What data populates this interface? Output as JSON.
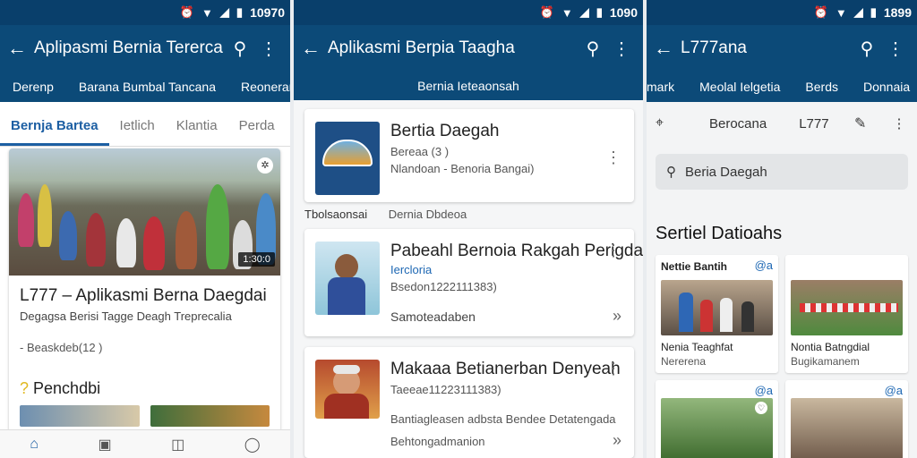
{
  "screen1": {
    "status": {
      "time": "10970"
    },
    "appbar": {
      "back_icon": "arrow-left-icon",
      "title": "Aplipasmi Bernia Tererca",
      "search_icon": "search-icon",
      "more_icon": "more-vert-icon"
    },
    "subnav": [
      "Derenp",
      "Barana  Bumbal Tancana",
      "Reonerana"
    ],
    "tabs": [
      {
        "label": "Bernja Bartea",
        "active": true
      },
      {
        "label": "Ietlich",
        "active": false
      },
      {
        "label": "Klantia",
        "active": false
      },
      {
        "label": "Perda",
        "active": false
      }
    ],
    "card": {
      "duration": "1:30:0",
      "title": "L777 – Aplikasmi Berna Daegdai",
      "subtitle": "Degagsa Berisi Tagge Deagh Treprecalia",
      "meta": "- Beaskdeb(12 )",
      "section": "Penchdbi"
    },
    "bottomnav": [
      "home-icon",
      "news-icon",
      "bookmark-icon",
      "chat-icon"
    ]
  },
  "screen2": {
    "status": {
      "time": "1090"
    },
    "appbar": {
      "back_icon": "arrow-left-icon",
      "title": "Aplikasmi Berpia Taagha",
      "search_icon": "search-icon",
      "more_icon": "more-vert-icon"
    },
    "subtitle": "Bernia Ieteaonsah",
    "app": {
      "title": "Bertia Daegah",
      "line1": "Bereaa (3 )",
      "line2": "Nlandoan - Benoria Bangai)"
    },
    "section": {
      "left": "Tbolsaonsai",
      "right": "Dernia Dbdeoa"
    },
    "items": [
      {
        "title": "Pabeahl Bernoia  Rakgah Perigdai",
        "link": "Iercloria",
        "meta": "Bsedon1222111383)",
        "foot": "Samoteadaben"
      },
      {
        "title": "Makaaa Betianerban Denyeah",
        "link": "",
        "meta": "Taeeae11223111383)",
        "foot": "Bantiagleasen adbsta Bendee Detatengada",
        "foot2": "Behtongadmanion"
      }
    ]
  },
  "screen3": {
    "status": {
      "time": "1899"
    },
    "appbar": {
      "back_icon": "arrow-left-icon",
      "title": "L777ana",
      "search_icon": "search-icon",
      "more_icon": "more-vert-icon"
    },
    "subnav": [
      "mark",
      "Meolal Ielgetia",
      "Berds",
      "Donnaia"
    ],
    "toolbar": {
      "left_icon": "pin-icon",
      "label1": "Berocana",
      "label2": "L777",
      "pen_icon": "pen-icon",
      "more_icon": "more-vert-icon"
    },
    "search": {
      "text": "Beria Daegah"
    },
    "heading": "Sertiel Datioahs",
    "cards": [
      {
        "head": "Nettie Bantih",
        "badge": "@a",
        "title": "Nenia Teaghfat",
        "sub": "Nererena"
      },
      {
        "head": "",
        "badge": "",
        "title": "Nontia Batngdial",
        "sub": "Bugikamanem"
      },
      {
        "head": "",
        "badge": "@a",
        "title": "",
        "sub": ""
      },
      {
        "head": "",
        "badge": "@a",
        "title": "",
        "sub": ""
      }
    ]
  }
}
